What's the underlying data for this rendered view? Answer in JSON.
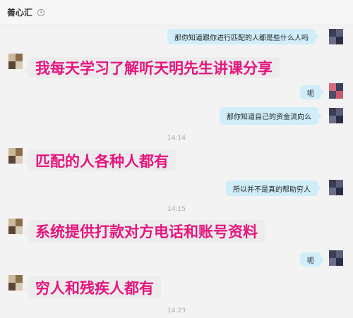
{
  "header": {
    "title": "善心汇",
    "clock_icon": "clock-icon"
  },
  "messages": {
    "m1": "那你知道跟你进行匹配的人都是些什么人吗",
    "m2": "我每天学习了解听天明先生讲课分享",
    "m3": "呃",
    "m4": "那你知道自己的资金流向么",
    "t1": "14:14",
    "m5": "匹配的人各种人都有",
    "m6": "所以并不是真的帮助穷人",
    "t2": "14:15",
    "m7": "系统提供打款对方电话和账号资料",
    "m8": "呃",
    "m9": "穷人和残疾人都有",
    "t3": "14:23"
  },
  "colors": {
    "incoming_text": "#e6157d",
    "incoming_bubble": "#ececec",
    "outgoing_bubble": "#cfeef9",
    "background": "#f3f3f3"
  }
}
